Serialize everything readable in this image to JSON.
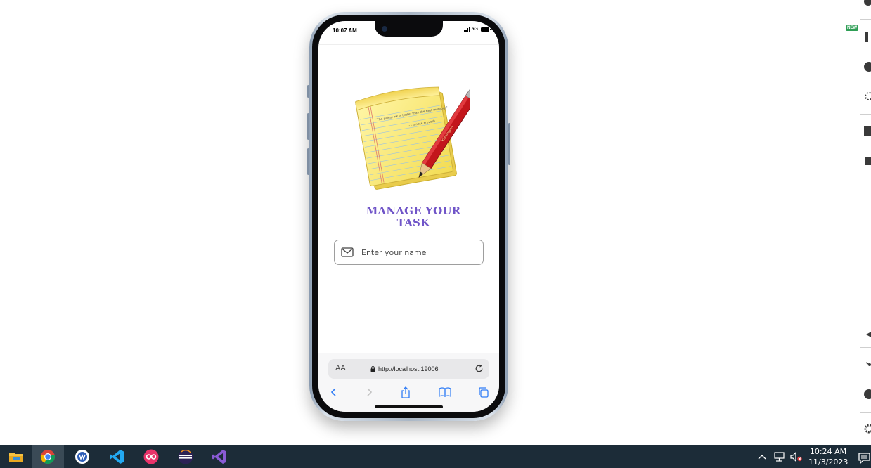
{
  "phone": {
    "status_time": "10:07 AM",
    "network": "5G",
    "app": {
      "title": "MANAGE YOUR TASK",
      "name_input": {
        "placeholder": "Enter your name",
        "value": ""
      },
      "illustration_quote": "\"The palest ink is better than the best memory.\"",
      "illustration_attribution": "- Chinese Proverb",
      "pencil_text": "Kensington"
    },
    "browser": {
      "text_size_label": "AA",
      "url": "http://localhost:19006"
    }
  },
  "side_rail": {
    "badge": "NEW"
  },
  "taskbar": {
    "apps": [
      "file-explorer",
      "chrome",
      "wps",
      "vscode",
      "app-red",
      "eclipse",
      "visual-studio"
    ],
    "time": "10:24 AM",
    "date": "11/3/2023"
  },
  "colors": {
    "title": "#7055c8",
    "taskbar": "#1c2c38",
    "ios_blue": "#2f7cf6"
  }
}
